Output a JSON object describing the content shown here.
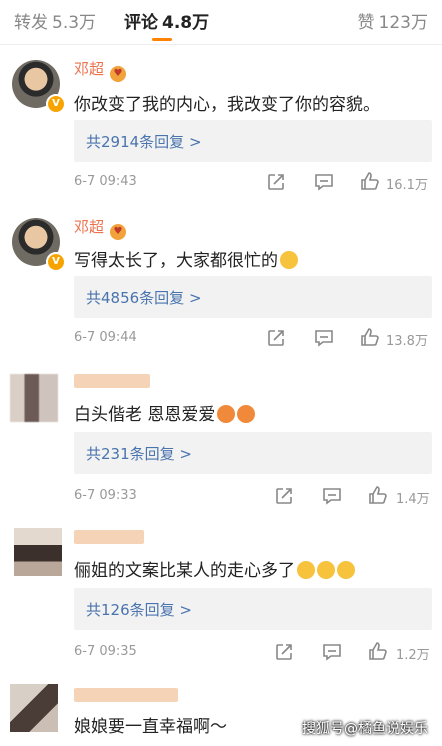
{
  "tabs": {
    "repost": {
      "label": "转发",
      "count": "5.3万"
    },
    "comment": {
      "label": "评论",
      "count": "4.8万"
    },
    "like": {
      "label": "赞",
      "count": "123万"
    }
  },
  "comments": [
    {
      "author": "邓超",
      "text": "你改变了我的内心，我改变了你的容貌。",
      "replies": "共2914条回复 >",
      "time": "6-7 09:43",
      "likes": "16.1万"
    },
    {
      "author": "邓超",
      "text": "写得太长了，大家都很忙的",
      "replies": "共4856条回复 >",
      "time": "6-7 09:44",
      "likes": "13.8万"
    },
    {
      "author": "",
      "text": "白头偕老 恩恩爱爱",
      "replies": "共231条回复 >",
      "time": "6-7 09:33",
      "likes": "1.4万"
    },
    {
      "author": "",
      "text": "俪姐的文案比某人的走心多了",
      "replies": "共126条回复 >",
      "time": "6-7 09:35",
      "likes": "1.2万"
    },
    {
      "author": "",
      "text": "娘娘要一直幸福啊～"
    }
  ],
  "watermark": "搜狐号@橘鱼说娱乐",
  "colors": {
    "accent": "#ff8200",
    "name": "#eb7350",
    "link": "#4a74ad"
  },
  "icons": [
    "share-icon",
    "comment-icon",
    "thumb-up-icon",
    "v-badge-icon",
    "emoji-icon"
  ]
}
